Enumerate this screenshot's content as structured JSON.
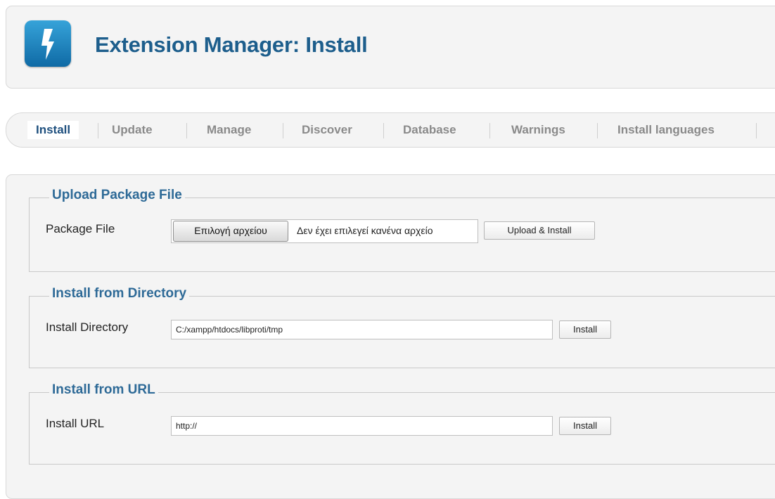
{
  "header": {
    "title": "Extension Manager: Install",
    "logo_icon": "lightning-bolt-icon",
    "logo_color": "#1f80c0"
  },
  "tabs": [
    {
      "label": "Install",
      "active": true
    },
    {
      "label": "Update",
      "active": false
    },
    {
      "label": "Manage",
      "active": false
    },
    {
      "label": "Discover",
      "active": false
    },
    {
      "label": "Database",
      "active": false
    },
    {
      "label": "Warnings",
      "active": false
    },
    {
      "label": "Install languages",
      "active": false
    }
  ],
  "upload": {
    "legend": "Upload Package File",
    "label": "Package File",
    "choose_label": "Επιλογή αρχείου",
    "no_file_text": "Δεν έχει επιλεγεί κανένα αρχείο",
    "button": "Upload & Install"
  },
  "directory": {
    "legend": "Install from Directory",
    "label": "Install Directory",
    "value": "C:/xampp/htdocs/libproti/tmp",
    "button": "Install"
  },
  "url": {
    "legend": "Install from URL",
    "label": "Install URL",
    "value": "http://",
    "button": "Install"
  },
  "colors": {
    "title": "#1d5e8c",
    "legend": "#2e6a97",
    "tab_active": "#1e4f7e",
    "tab_inactive": "#8a8a8a"
  }
}
